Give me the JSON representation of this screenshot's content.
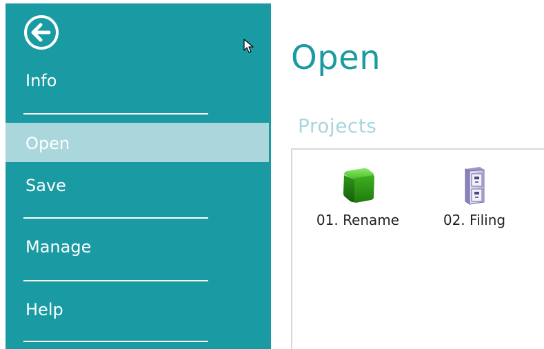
{
  "sidebar": {
    "back_icon": "back-arrow-icon",
    "items": [
      {
        "label": "Info",
        "selected": false
      },
      {
        "label": "Open",
        "selected": true
      },
      {
        "label": "Save",
        "selected": false
      },
      {
        "label": "Manage",
        "selected": false
      },
      {
        "label": "Help",
        "selected": false
      }
    ],
    "background": "#1a9aa2",
    "selected_background": "#aad7dc"
  },
  "main": {
    "title": "Open",
    "section_title": "Projects",
    "projects": [
      {
        "name": "01. Rename",
        "icon": "green-cube-icon"
      },
      {
        "name": "02. Filing",
        "icon": "filing-cabinet-icon"
      }
    ]
  },
  "colors": {
    "accent": "#1a9aa2",
    "section_title": "#a8d6dc"
  }
}
